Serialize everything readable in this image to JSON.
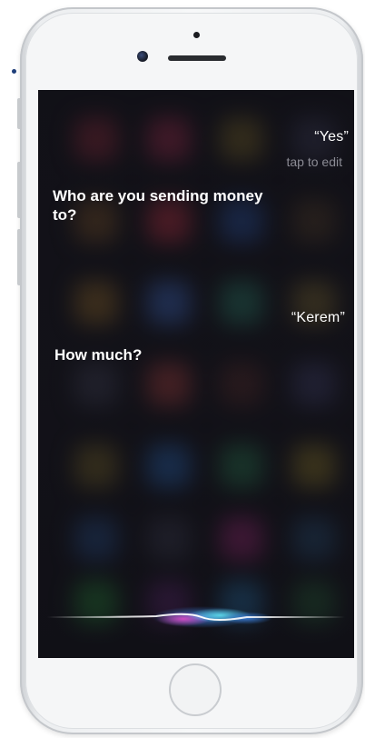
{
  "conversation": {
    "user_reply_1": "“Yes”",
    "tap_to_edit": "tap to edit",
    "siri_question_1": "Who are you sending money to?",
    "user_reply_2": "“Kerem”",
    "siri_question_2": "How much?"
  },
  "device": {
    "name": "iPhone (white)"
  },
  "colors": {
    "screen_background": "#1a1920",
    "text_primary": "#ffffff",
    "text_secondary": "#8b8b94",
    "siri_wave_blue": "#3a7bd5",
    "siri_wave_pink": "#e04ac8",
    "siri_wave_cyan": "#5ee0f0"
  }
}
